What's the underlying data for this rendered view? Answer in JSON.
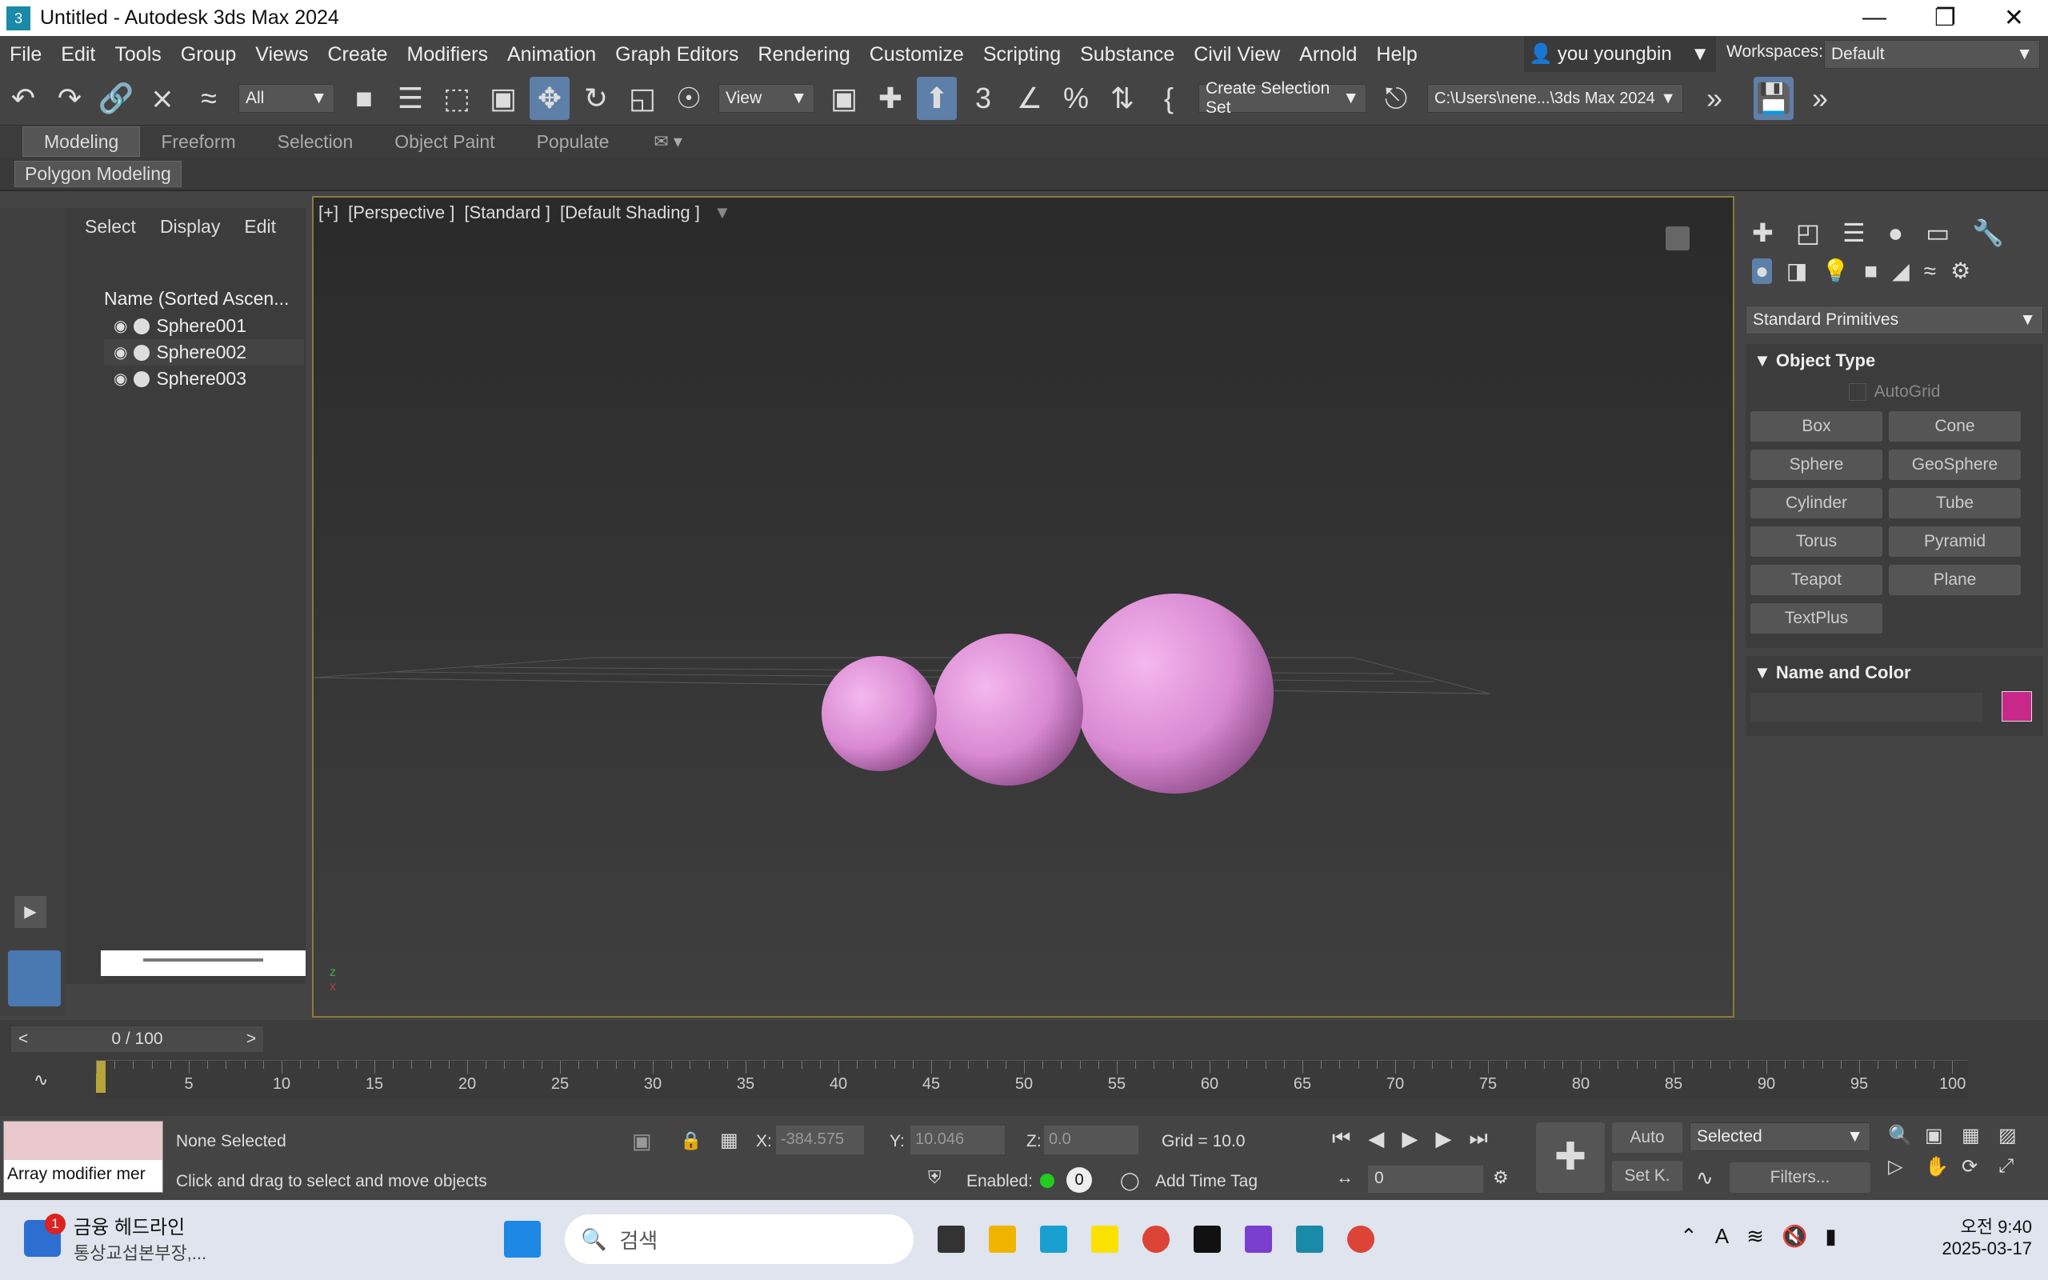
{
  "window": {
    "title": "Untitled - Autodesk 3ds Max 2024",
    "app_badge": "3"
  },
  "menu": [
    "File",
    "Edit",
    "Tools",
    "Group",
    "Views",
    "Create",
    "Modifiers",
    "Animation",
    "Graph Editors",
    "Rendering",
    "Customize",
    "Scripting",
    "Substance",
    "Civil View",
    "Arnold",
    "Help"
  ],
  "user": {
    "name": "you youngbin",
    "workspaces_label": "Workspaces:",
    "workspace": "Default"
  },
  "toolbar": {
    "filter": "All",
    "refcoord": "View",
    "selection_set": "Create Selection Set",
    "path": "C:\\Users\\nene...\\3ds Max 2024"
  },
  "ribbon": {
    "tabs": [
      "Modeling",
      "Freeform",
      "Selection",
      "Object Paint",
      "Populate"
    ],
    "active": "Modeling",
    "sub": "Polygon Modeling"
  },
  "scene": {
    "menu": [
      "Select",
      "Display",
      "Edit"
    ],
    "header": "Name (Sorted Ascen...",
    "objects": [
      "Sphere001",
      "Sphere002",
      "Sphere003"
    ]
  },
  "viewport": {
    "labels": [
      "[+]",
      "[Perspective ]",
      "[Standard ]",
      "[Default Shading ]"
    ]
  },
  "command": {
    "category": "Standard Primitives",
    "object_type_title": "Object Type",
    "autogrid": "AutoGrid",
    "buttons": [
      "Box",
      "Cone",
      "Sphere",
      "GeoSphere",
      "Cylinder",
      "Tube",
      "Torus",
      "Pyramid",
      "Teapot",
      "Plane",
      "TextPlus"
    ],
    "name_color_title": "Name and Color",
    "swatch_color": "#c8288a"
  },
  "timeline": {
    "frame": "0 / 100",
    "ticks": [
      "5",
      "10",
      "15",
      "20",
      "25",
      "30",
      "35",
      "40",
      "45",
      "50",
      "55",
      "60",
      "65",
      "70",
      "75",
      "80",
      "85",
      "90",
      "95",
      "100"
    ]
  },
  "status": {
    "maxscript": "Array modifier mer",
    "selection": "None Selected",
    "prompt": "Click and drag to select and move objects",
    "x_label": "X:",
    "x": "-384.575",
    "y_label": "Y:",
    "y": "10.046",
    "z_label": "Z:",
    "z": "0.0",
    "grid": "Grid = 10.0",
    "enabled": "Enabled:",
    "time_tag": "Add Time Tag",
    "auto": "Auto",
    "setk": "Set K.",
    "selected": "Selected",
    "filters": "Filters...",
    "frame_field": "0",
    "enabled_count": "0"
  },
  "taskbar": {
    "news_title": "금융 헤드라인",
    "news_sub": "통상교섭본부장,...",
    "news_badge": "1",
    "search": "검색",
    "time": "오전 9:40",
    "date": "2025-03-17"
  }
}
